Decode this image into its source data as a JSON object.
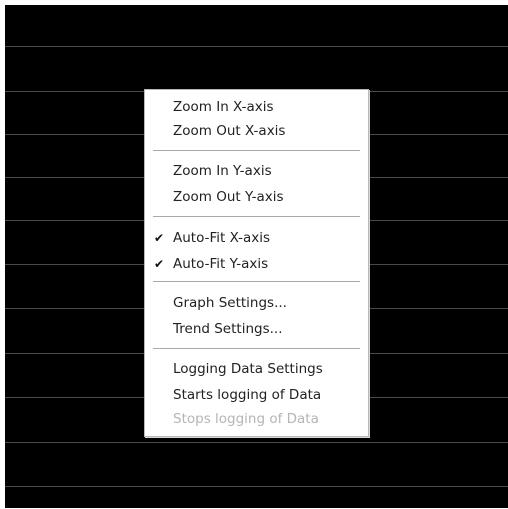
{
  "menu": {
    "zoom_in_x": "Zoom In X-axis",
    "zoom_out_x": "Zoom Out X-axis",
    "zoom_in_y": "Zoom In Y-axis",
    "zoom_out_y": "Zoom Out Y-axis",
    "auto_fit_x": "Auto-Fit X-axis",
    "auto_fit_y": "Auto-Fit Y-axis",
    "graph_settings": "Graph Settings...",
    "trend_settings": "Trend Settings...",
    "logging_data_settings": "Logging Data Settings",
    "starts_logging": "Starts logging of Data",
    "stops_logging": "Stops logging of Data"
  },
  "checks": {
    "auto_fit_x": "✔",
    "auto_fit_y": "✔"
  },
  "icons": {
    "auto_fit_x_check": "check-icon",
    "auto_fit_y_check": "check-icon"
  },
  "colors": {
    "graph_background": "#000000",
    "grid_lines": "#4a4a4a",
    "menu_background": "#ffffff",
    "menu_text": "#222222",
    "disabled_text": "#b5b5b5",
    "separator": "#a9a9a9"
  }
}
